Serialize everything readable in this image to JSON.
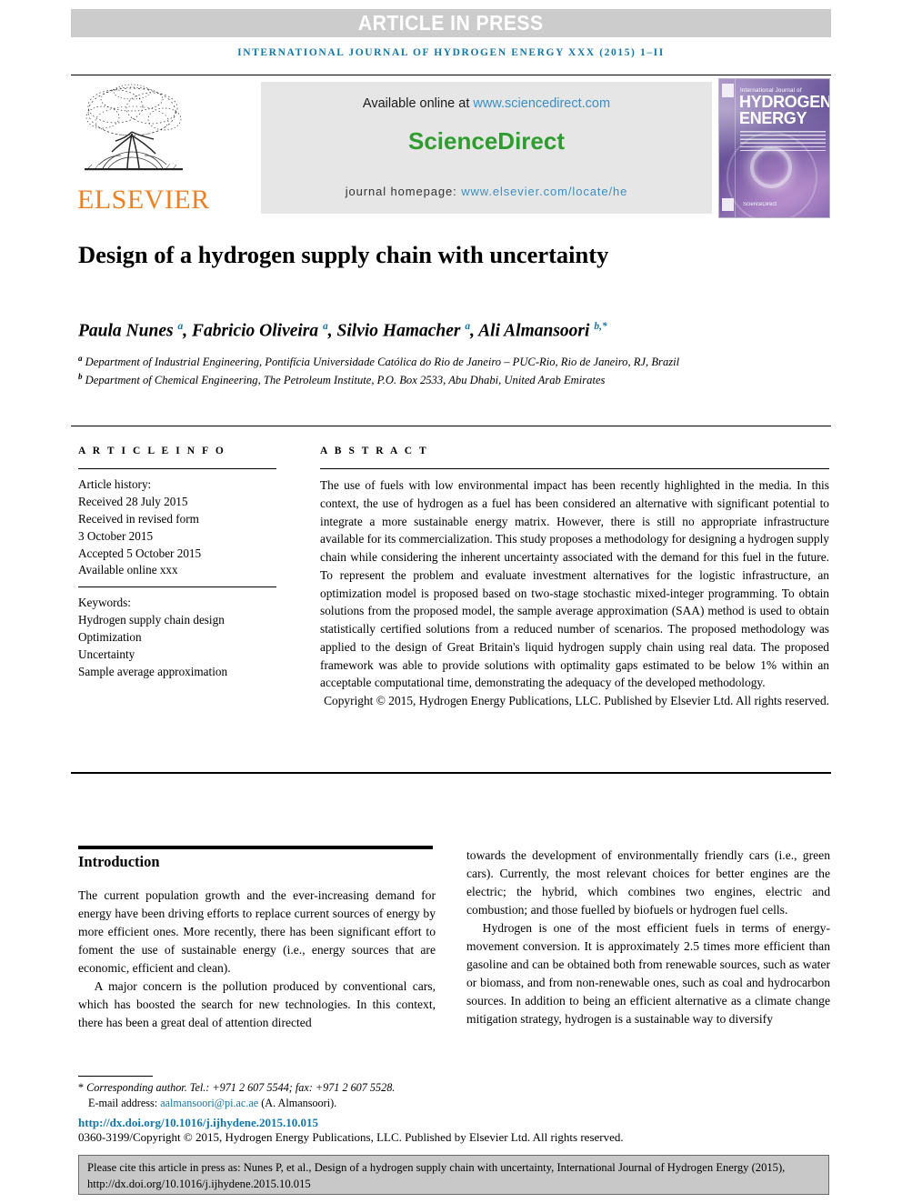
{
  "banner": {
    "text": "ARTICLE IN PRESS"
  },
  "running_head": "INTERNATIONAL JOURNAL OF HYDROGEN ENERGY XXX (2015) 1–II",
  "masthead": {
    "publisher": "ELSEVIER",
    "available_label": "Available online at ",
    "available_link": "www.sciencedirect.com",
    "sciencedirect": "ScienceDirect",
    "homepage_label": "journal homepage: ",
    "homepage_link": "www.elsevier.com/locate/he",
    "cover": {
      "line_small": "International Journal of",
      "line1": "HYDROGEN",
      "line2": "ENERGY",
      "sciencedirect_mark": "ScienceDirect"
    }
  },
  "article": {
    "title": "Design of a hydrogen supply chain with uncertainty",
    "authors_html": "Paula Nunes <sup>a</sup>, Fabricio Oliveira <sup>a</sup>, Silvio Hamacher <sup>a</sup>, Ali Almansoori <sup>b,*</sup>",
    "affiliation_a": "Department of Industrial Engineering, Pontifícia Universidade Católica do Rio de Janeiro – PUC-Rio, Rio de Janeiro, RJ, Brazil",
    "affiliation_b": "Department of Chemical Engineering, The Petroleum Institute, P.O. Box 2533, Abu Dhabi, United Arab Emirates"
  },
  "article_info": {
    "heading": "A R T I C L E   I N F O",
    "history_label": "Article history:",
    "received": "Received 28 July 2015",
    "revised_label": "Received in revised form",
    "revised_date": "3 October 2015",
    "accepted": "Accepted 5 October 2015",
    "available_online": "Available online xxx",
    "keywords_label": "Keywords:",
    "keywords": [
      "Hydrogen supply chain design",
      "Optimization",
      "Uncertainty",
      "Sample average approximation"
    ]
  },
  "abstract": {
    "heading": "A B S T R A C T",
    "body": "The use of fuels with low environmental impact has been recently highlighted in the media. In this context, the use of hydrogen as a fuel has been considered an alternative with significant potential to integrate a more sustainable energy matrix. However, there is still no appropriate infrastructure available for its commercialization. This study proposes a methodology for designing a hydrogen supply chain while considering the inherent uncertainty associated with the demand for this fuel in the future. To represent the problem and evaluate investment alternatives for the logistic infrastructure, an optimization model is proposed based on two-stage stochastic mixed-integer programming. To obtain solutions from the proposed model, the sample average approximation (SAA) method is used to obtain statistically certified solutions from a reduced number of scenarios. The proposed methodology was applied to the design of Great Britain's liquid hydrogen supply chain using real data. The proposed framework was able to provide solutions with optimality gaps estimated to be below 1% within an acceptable computational time, demonstrating the adequacy of the developed methodology.",
    "copyright": "Copyright © 2015, Hydrogen Energy Publications, LLC. Published by Elsevier Ltd. All rights reserved."
  },
  "introduction": {
    "heading": "Introduction",
    "left_paragraphs": [
      "The current population growth and the ever-increasing demand for energy have been driving efforts to replace current sources of energy by more efficient ones. More recently, there has been significant effort to foment the use of sustainable energy (i.e., energy sources that are economic, efficient and clean).",
      "A major concern is the pollution produced by conventional cars, which has boosted the search for new technologies. In this context, there has been a great deal of attention directed"
    ],
    "right_paragraphs": [
      "towards the development of environmentally friendly cars (i.e., green cars). Currently, the most relevant choices for better engines are the electric; the hybrid, which combines two engines, electric and combustion; and those fuelled by biofuels or hydrogen fuel cells.",
      "Hydrogen is one of the most efficient fuels in terms of energy-movement conversion. It is approximately 2.5 times more efficient than gasoline and can be obtained both from renewable sources, such as water or biomass, and from non-renewable ones, such as coal and hydrocarbon sources. In addition to being an efficient alternative as a climate change mitigation strategy, hydrogen is a sustainable way to diversify"
    ]
  },
  "footer": {
    "corresponding_mark": "*",
    "corresponding": " Corresponding author. Tel.: +971 2 607 5544; fax: +971 2 607 5528.",
    "email_label": "E-mail address: ",
    "email": "aalmansoori@pi.ac.ae",
    "email_suffix": " (A. Almansoori).",
    "doi": "http://dx.doi.org/10.1016/j.ijhydene.2015.10.015",
    "issn": "0360-3199/Copyright © 2015, Hydrogen Energy Publications, LLC. Published by Elsevier Ltd. All rights reserved.",
    "cite_box": "Please cite this article in press as: Nunes P, et al., Design of a hydrogen supply chain with uncertainty, International Journal of Hydrogen Energy (2015), http://dx.doi.org/10.1016/j.ijhydene.2015.10.015"
  },
  "colors": {
    "link_blue": "#1277a8",
    "sd_green": "#2e9c2e",
    "elsevier_orange": "#ec8124",
    "banner_gray": "#cccccc",
    "cite_box_gray": "#c8c8c8"
  }
}
